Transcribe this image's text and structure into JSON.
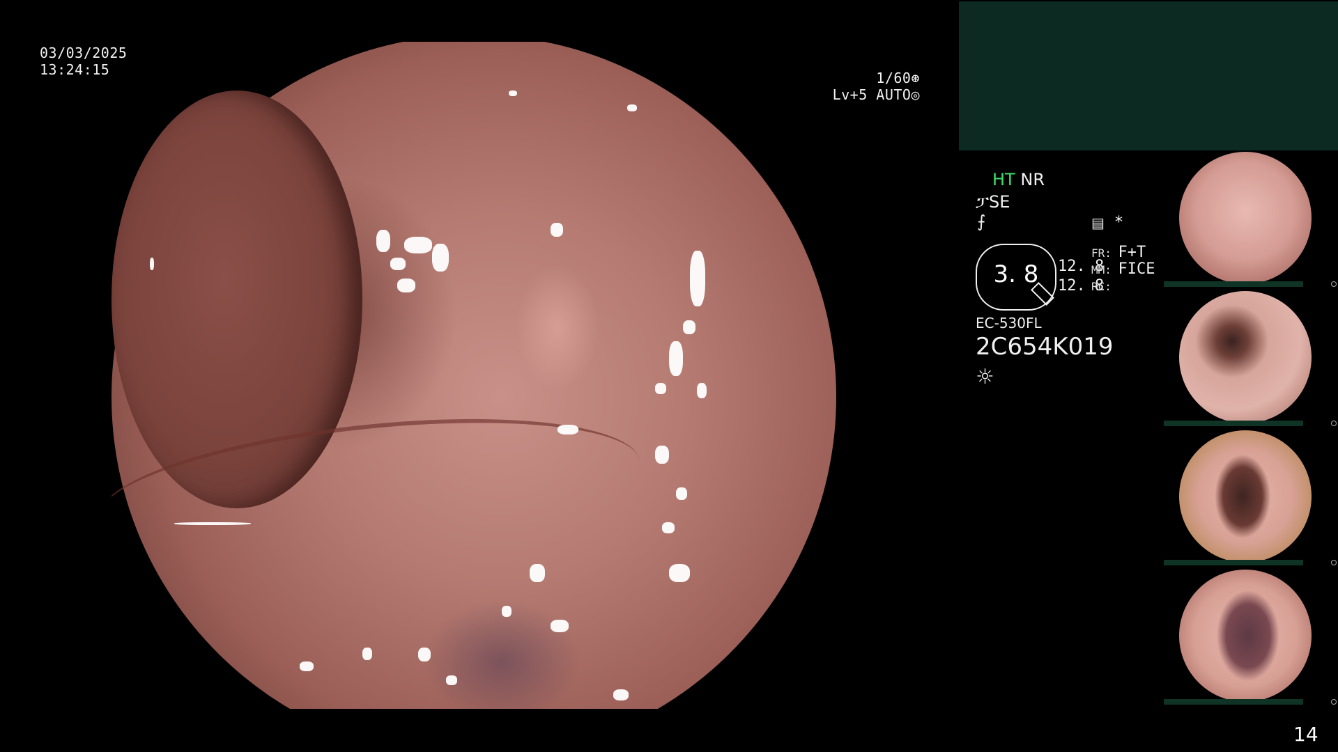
{
  "datetime": {
    "date": "03/03/2025",
    "time": "13:24:15"
  },
  "exposure": {
    "shutter": "1/60",
    "level": "Lv+5 AUTO"
  },
  "modes": {
    "ht": "HT",
    "nr": "NR",
    "se": "SE"
  },
  "gauge": {
    "value": "3. 8"
  },
  "readouts": {
    "val1": "12. 8",
    "val2": "12. 8",
    "fr_label": "FR:",
    "fr_value": "F+T",
    "mm_label": "MM:",
    "mm_value": "FICE",
    "rc_label": "RC:"
  },
  "scope": {
    "model": "EC-530FL",
    "serial": "2C654K019"
  },
  "page_number": "14",
  "colors": {
    "accent_green": "#3ee06a",
    "preview_panel": "#0d2a22",
    "thumb_bar": "#0f3426"
  },
  "icons": [
    "shutter-icon",
    "auto-iris-icon",
    "scope-bend-icon",
    "function-icon",
    "menu-icon",
    "asterisk-icon",
    "light-icon"
  ]
}
